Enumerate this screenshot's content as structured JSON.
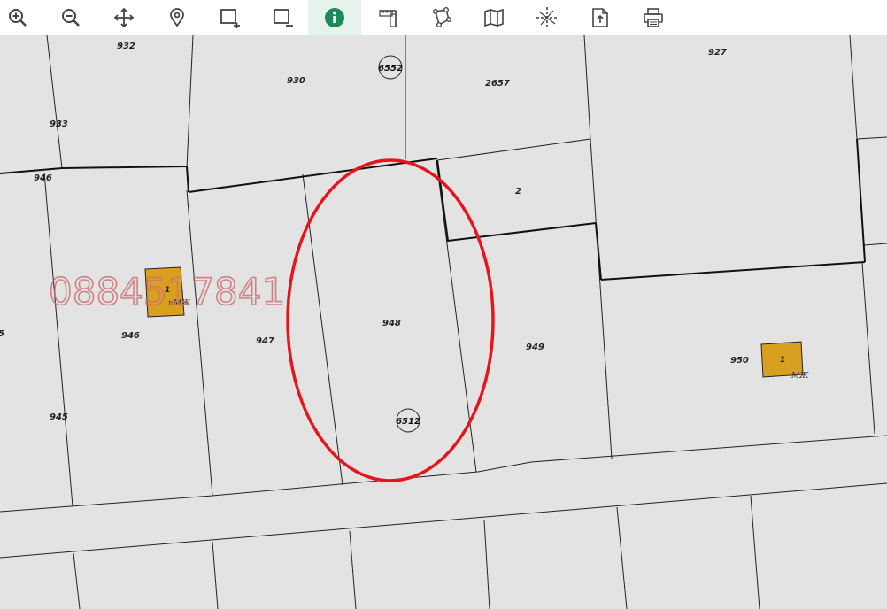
{
  "toolbar": {
    "tools": [
      {
        "name": "zoom-in-icon"
      },
      {
        "name": "zoom-out-icon"
      },
      {
        "name": "pan-icon"
      },
      {
        "name": "location-pin-icon"
      },
      {
        "name": "zoom-box-in-icon"
      },
      {
        "name": "zoom-box-out-icon"
      },
      {
        "name": "info-icon",
        "active": true
      },
      {
        "name": "measure-distance-icon"
      },
      {
        "name": "measure-area-icon"
      },
      {
        "name": "map-icon"
      },
      {
        "name": "coordinates-icon"
      },
      {
        "name": "export-icon"
      },
      {
        "name": "print-icon"
      }
    ],
    "active_color": "#1a8a5a"
  },
  "map": {
    "watermark": "0884517841",
    "parcels": {
      "p932": "932",
      "p930": "930",
      "p2657": "2657",
      "p927": "927",
      "p933": "933",
      "p946_top": "946",
      "p2": "2",
      "p946": "946",
      "p947": "947",
      "p948": "948",
      "p949": "949",
      "p950": "950",
      "p945": "945",
      "p_edge": "5"
    },
    "circled": {
      "c6552": "6552",
      "c6512": "6512"
    },
    "buildings": {
      "b_left_num": "1",
      "b_left_type": "пМЖ",
      "b_right_num": "1",
      "b_right_type": "МЖ"
    },
    "colors": {
      "building": "#d9a020",
      "highlight": "#e8141c",
      "background": "#e3e3e3"
    }
  }
}
